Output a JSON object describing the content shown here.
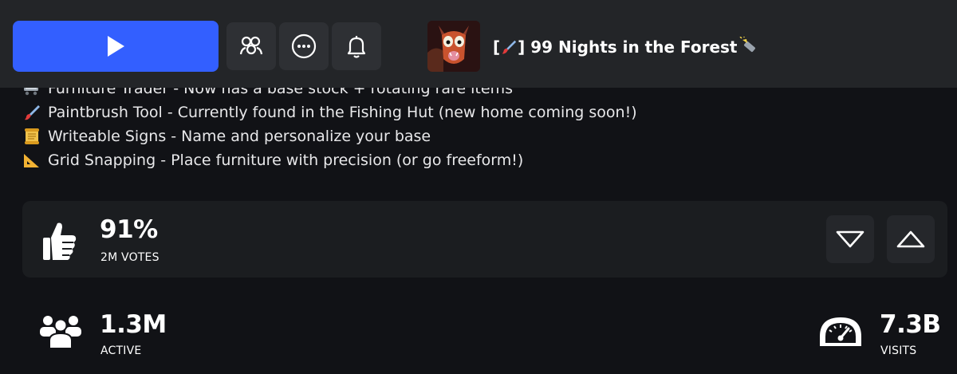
{
  "header": {
    "play_button": {
      "icon": "play-icon",
      "color": "#335fff"
    },
    "buttons": [
      {
        "name": "friends-button",
        "icon": "friends-icon"
      },
      {
        "name": "more-options-button",
        "icon": "ellipsis-icon"
      },
      {
        "name": "notify-button",
        "icon": "bell-icon"
      }
    ],
    "game_icon": "game-thumbnail",
    "title_prefix": "[",
    "title_suffix": "] 99 Nights in the Forest",
    "title_prefix_icon": "paintbrush-icon",
    "title_suffix_icon": "flashlight-icon"
  },
  "description": [
    {
      "icon": "cart-icon",
      "text": "Furniture Trader - Now has a base stock + rotating rare items"
    },
    {
      "icon": "paintbrush-icon",
      "text": "Paintbrush Tool - Currently found in the Fishing Hut (new home coming soon!)"
    },
    {
      "icon": "scroll-icon",
      "text": "Writeable Signs - Name and personalize your base"
    },
    {
      "icon": "triangle-ruler-icon",
      "text": "Grid Snapping - Place furniture with precision (or go freeform!)"
    }
  ],
  "votes": {
    "percent": "91%",
    "count_label": "2M VOTES",
    "thumb_icon": "thumbs-up-icon",
    "downvote_icon": "chevron-down-icon",
    "upvote_icon": "chevron-up-icon"
  },
  "stats": {
    "active": {
      "value": "1.3M",
      "label": "ACTIVE",
      "icon": "people-icon"
    },
    "visits": {
      "value": "7.3B",
      "label": "VISITS",
      "icon": "speedometer-icon"
    }
  }
}
